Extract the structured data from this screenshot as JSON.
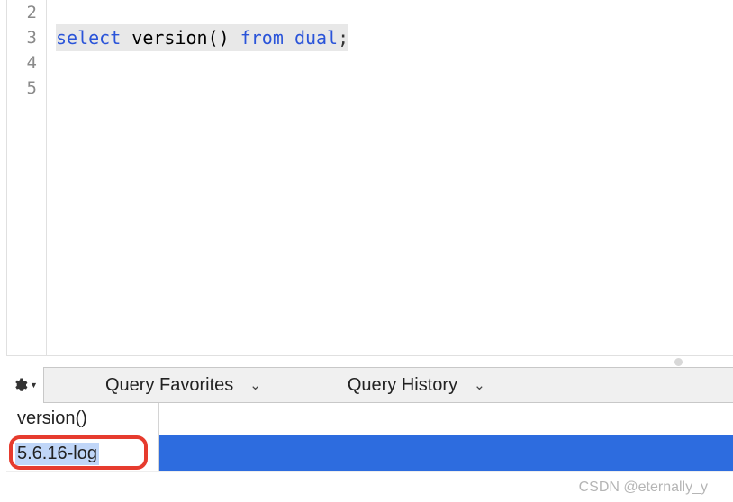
{
  "editor": {
    "lines": [
      {
        "num": "2",
        "tokens": []
      },
      {
        "num": "3",
        "tokens": [
          {
            "t": "select",
            "cls": "kw"
          },
          {
            "t": " ",
            "cls": ""
          },
          {
            "t": "version()",
            "cls": "fn"
          },
          {
            "t": " ",
            "cls": ""
          },
          {
            "t": "from",
            "cls": "kw-from"
          },
          {
            "t": " ",
            "cls": ""
          },
          {
            "t": "dual",
            "cls": "tbl"
          },
          {
            "t": ";",
            "cls": "semi"
          }
        ],
        "selected": true
      },
      {
        "num": "4",
        "tokens": []
      },
      {
        "num": "5",
        "tokens": []
      }
    ]
  },
  "toolbar": {
    "favorites_label": "Query Favorites",
    "history_label": "Query History"
  },
  "results": {
    "column_header": "version()",
    "cell_value": "5.6.16-log"
  },
  "footer": {
    "watermark": "CSDN @eternally_y"
  }
}
